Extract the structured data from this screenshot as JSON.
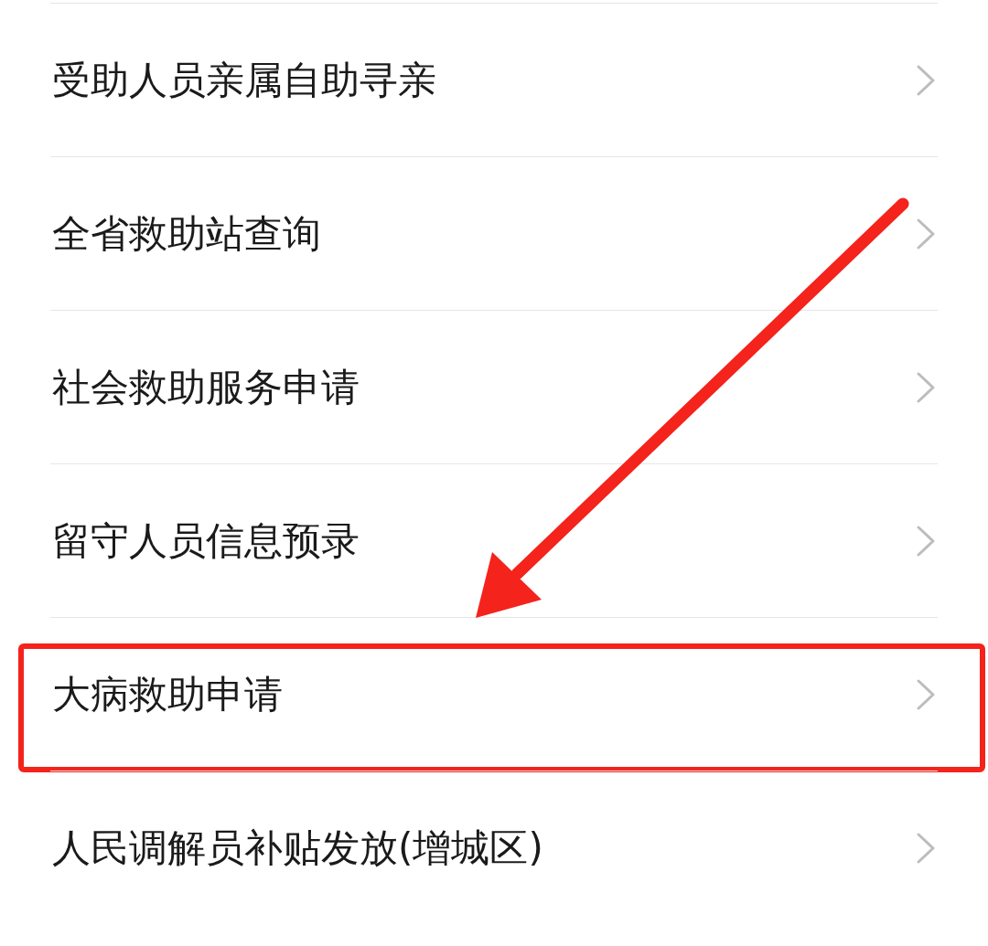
{
  "menu": {
    "items": [
      {
        "label": "受助人员亲属自助寻亲",
        "highlighted": false
      },
      {
        "label": "全省救助站查询",
        "highlighted": false
      },
      {
        "label": "社会救助服务申请",
        "highlighted": false
      },
      {
        "label": "留守人员信息预录",
        "highlighted": false
      },
      {
        "label": "大病救助申请",
        "highlighted": true
      },
      {
        "label": "人民调解员补贴发放(增城区)",
        "highlighted": false
      }
    ]
  }
}
